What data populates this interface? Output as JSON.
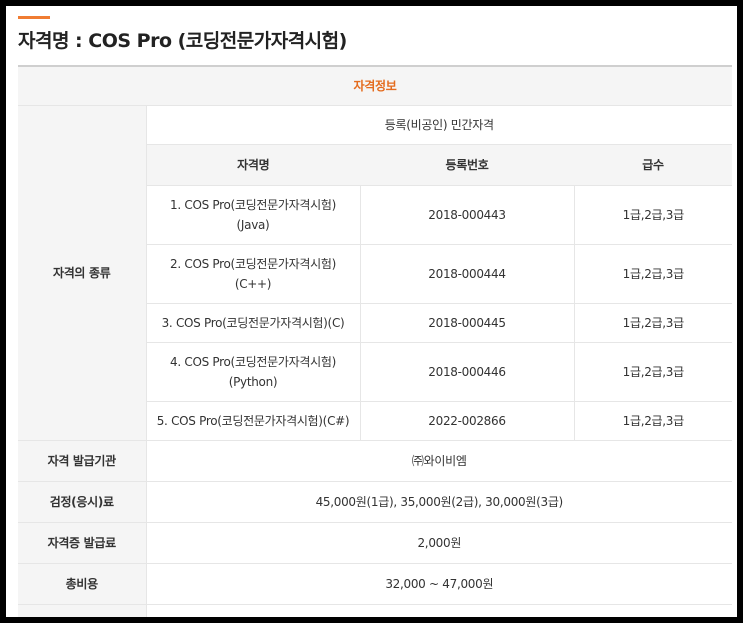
{
  "page": {
    "title": "자격명 : COS Pro (코딩전문가자격시험)",
    "accent_color": "#f07c32"
  },
  "table": {
    "section_title": "자격정보",
    "type_label": "자격의 종류",
    "type_value": "등록(비공인) 민간자격",
    "columns": [
      "자격명",
      "등록번호",
      "급수"
    ],
    "rows": [
      {
        "name_line1": "1. COS Pro(코딩전문가자격시험)",
        "name_line2": "(Java)",
        "reg": "2018-000443",
        "grade": "1급,2급,3급"
      },
      {
        "name_line1": "2. COS Pro(코딩전문가자격시험)",
        "name_line2": "(C++)",
        "reg": "2018-000444",
        "grade": "1급,2급,3급"
      },
      {
        "name_line1": "3. COS Pro(코딩전문가자격시험)(C)",
        "name_line2": "",
        "reg": "2018-000445",
        "grade": "1급,2급,3급"
      },
      {
        "name_line1": "4. COS Pro(코딩전문가자격시험)",
        "name_line2": "(Python)",
        "reg": "2018-000446",
        "grade": "1급,2급,3급"
      },
      {
        "name_line1": "5. COS Pro(코딩전문가자격시험)(C#)",
        "name_line2": "",
        "reg": "2022-002866",
        "grade": "1급,2급,3급"
      }
    ],
    "details": [
      {
        "label": "자격 발급기관",
        "value": "㈜와이비엠"
      },
      {
        "label": "검정(응시)료",
        "value": "45,000원(1급), 35,000원(2급), 30,000원(3급)"
      },
      {
        "label": "자격증 발급료",
        "value": "2,000원"
      },
      {
        "label": "총비용",
        "value": "32,000 ~ 47,000원"
      }
    ]
  }
}
